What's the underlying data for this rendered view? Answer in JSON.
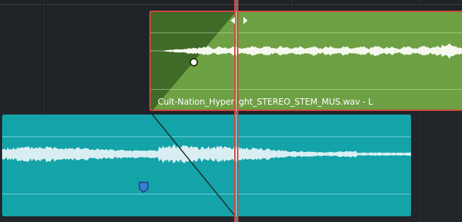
{
  "timeline": {
    "upper_clip": {
      "label": "Cult-Nation_Hyperlight_STEREO_STEM_MUS.wav - L",
      "color": "#6ea044",
      "selected_border_color": "#d2463f"
    },
    "lower_clip": {
      "color": "#14a3a9"
    },
    "playhead": {
      "color": "#d8443e"
    },
    "icons": {
      "trim_arrows": "trim-arrows-icon",
      "fade_handle": "fade-handle-icon",
      "marker": "marker-icon"
    }
  }
}
